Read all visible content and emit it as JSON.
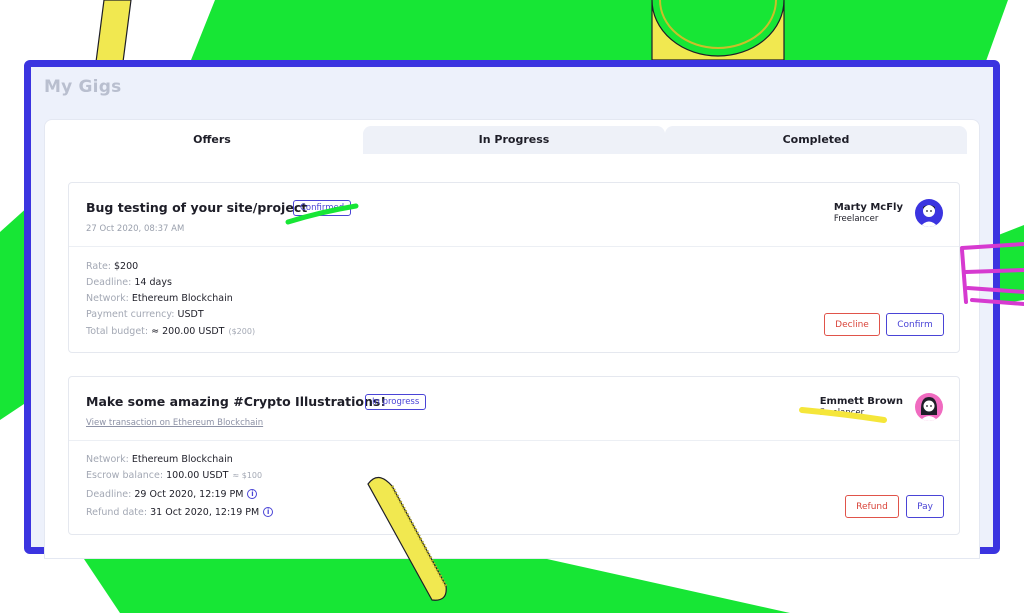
{
  "app": {
    "title": "My Gigs"
  },
  "tabs": [
    {
      "label": "Offers",
      "active": true
    },
    {
      "label": "In Progress",
      "active": false
    },
    {
      "label": "Completed",
      "active": false
    }
  ],
  "gigs": [
    {
      "title": "Bug testing of your site/project",
      "status": "Confirmed",
      "date": "27 Oct 2020, 08:37 AM",
      "person": {
        "name": "Marty McFly",
        "role": "Freelancer"
      },
      "details": {
        "rate_label": "Rate:",
        "rate": "$200",
        "deadline_label": "Deadline:",
        "deadline": "14 days",
        "network_label": "Network:",
        "network": "Ethereum Blockchain",
        "currency_label": "Payment currency:",
        "currency": "USDT",
        "budget_label": "Total budget:",
        "budget": "≈ 200.00 USDT",
        "budget_note": "($200)"
      },
      "actions": {
        "decline": "Decline",
        "confirm": "Confirm"
      }
    },
    {
      "title": "Make some amazing #Crypto Illustrations!",
      "status": "In progress",
      "link": "View transaction on Ethereum Blockchain",
      "person": {
        "name": "Emmett Brown",
        "role": "Freelancer"
      },
      "details": {
        "network_label": "Network:",
        "network": "Ethereum Blockchain",
        "escrow_label": "Escrow balance:",
        "escrow": "100.00 USDT",
        "escrow_note": "≈ $100",
        "deadline_label": "Deadline:",
        "deadline": "29 Oct 2020, 12:19 PM",
        "refund_label": "Refund date:",
        "refund": "31 Oct 2020, 12:19 PM"
      },
      "actions": {
        "refund": "Refund",
        "pay": "Pay"
      }
    }
  ],
  "colors": {
    "accent": "#3b34e0",
    "green": "#17e635",
    "yellow": "#f5e63a",
    "magenta": "#d63ad0",
    "decline": "#e0534a"
  }
}
